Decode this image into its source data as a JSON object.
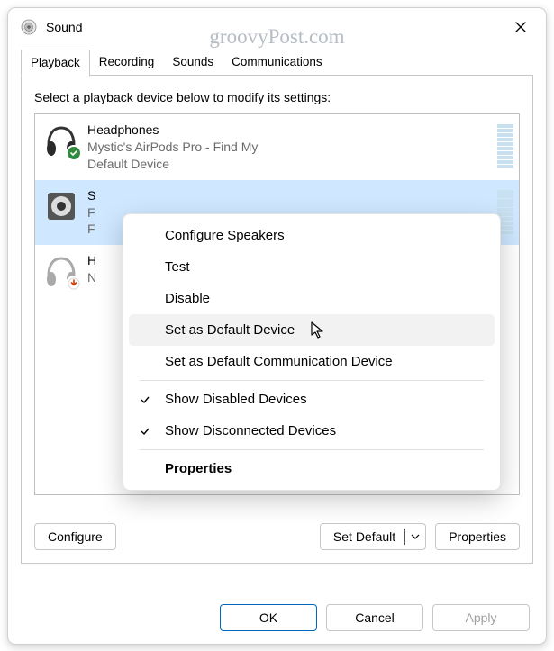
{
  "window": {
    "title": "Sound",
    "watermark": "groovyPost.com"
  },
  "tabs": {
    "items": [
      "Playback",
      "Recording",
      "Sounds",
      "Communications"
    ],
    "selected": 0
  },
  "playback": {
    "instruction": "Select a playback device below to modify its settings:",
    "devices": [
      {
        "name": "Headphones",
        "sub1": "Mystic's AirPods Pro - Find My",
        "sub2": "Default Device",
        "icon": "headphones",
        "badge": "check",
        "selected": false
      },
      {
        "name": "S",
        "sub1": "F",
        "sub2": "F",
        "icon": "speaker",
        "badge": "none",
        "selected": true
      },
      {
        "name": "H",
        "sub1": "N",
        "sub2": "",
        "icon": "headphones",
        "badge": "down",
        "selected": false
      }
    ],
    "buttons": {
      "configure": "Configure",
      "set_default": "Set Default",
      "properties": "Properties"
    }
  },
  "footer": {
    "ok": "OK",
    "cancel": "Cancel",
    "apply": "Apply"
  },
  "context_menu": {
    "items": [
      {
        "label": "Configure Speakers",
        "type": "item"
      },
      {
        "label": "Test",
        "type": "item"
      },
      {
        "label": "Disable",
        "type": "item"
      },
      {
        "label": "Set as Default Device",
        "type": "item",
        "hover": true
      },
      {
        "label": "Set as Default Communication Device",
        "type": "item"
      },
      {
        "type": "sep"
      },
      {
        "label": "Show Disabled Devices",
        "type": "check",
        "checked": true
      },
      {
        "label": "Show Disconnected Devices",
        "type": "check",
        "checked": true
      },
      {
        "type": "sep"
      },
      {
        "label": "Properties",
        "type": "item",
        "bold": true
      }
    ]
  }
}
